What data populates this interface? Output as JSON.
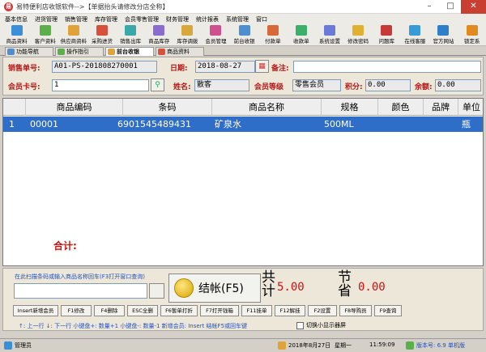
{
  "window": {
    "title": "易特便利店收银软件-->【单据抬头请修改分店全称】",
    "min": "–",
    "max": "□",
    "close": "✕"
  },
  "menu": [
    "基本信息",
    "进货管理",
    "销售管理",
    "库存管理",
    "会员零售管理",
    "财务管理",
    "统计报表",
    "系统管理",
    "窗口"
  ],
  "toolbar": [
    {
      "label": "商品资料",
      "color": "#3a8fd8"
    },
    {
      "label": "客户资料",
      "color": "#5bb04b"
    },
    {
      "label": "供应商资料",
      "color": "#e2a23a"
    },
    {
      "label": "采购进货",
      "color": "#d8503a"
    },
    {
      "label": "销售出库",
      "color": "#3aa8a8"
    },
    {
      "label": "商品库存",
      "color": "#8a6bd0"
    },
    {
      "label": "库存调拨",
      "color": "#d8a83a"
    },
    {
      "label": "会员管理",
      "color": "#cf4f8f"
    },
    {
      "label": "前台收银",
      "color": "#4f8fcf"
    },
    {
      "label": "付款单",
      "color": "#d86a3a"
    },
    {
      "label": "收款单",
      "color": "#3ab06a"
    },
    {
      "label": "系统设置",
      "color": "#6a7ad8"
    },
    {
      "label": "修改密码",
      "color": "#e0b030"
    },
    {
      "label": "问题库",
      "color": "#c83a3a"
    },
    {
      "label": "在线客服",
      "color": "#3a9ad8"
    },
    {
      "label": "官方网站",
      "color": "#2f7fc8"
    },
    {
      "label": "锁定系",
      "color": "#e08a20"
    }
  ],
  "tabs": [
    {
      "label": "功能导航",
      "color": "#4f8fcf",
      "active": false
    },
    {
      "label": "操作指引",
      "color": "#5bb04b",
      "active": false
    },
    {
      "label": "前台收银",
      "color": "#e2a23a",
      "active": true
    },
    {
      "label": "商品资料",
      "color": "#d8503a",
      "active": false
    }
  ],
  "form": {
    "order_no_label": "销售单号:",
    "order_no": "A01-PS-201808270001",
    "date_label": "日期:",
    "date": "2018-08-27",
    "note_label": "备注:",
    "note": "",
    "card_label": "会员卡号:",
    "card": "1",
    "name_label": "姓名:",
    "name": "散客",
    "level_label": "会员等级",
    "level": "零售会员",
    "points_label": "积分:",
    "points": "0.00",
    "balance_label": "余额:",
    "balance": "0.00"
  },
  "grid": {
    "headers": [
      "商品编码",
      "条码",
      "商品名称",
      "规格",
      "颜色",
      "品牌",
      "单位"
    ],
    "rows": [
      {
        "index": "1",
        "code": "00001",
        "barcode": "6901545489431",
        "name": "矿泉水",
        "spec": "500ML",
        "color": "",
        "brand": "",
        "unit": "瓶"
      }
    ],
    "total_label": "合计:"
  },
  "bottom": {
    "scan_label": "在此扫描条码或输入商品名称回车(F3打开窗口查询)",
    "checkout": "结帐(F5)",
    "sum_label": "共计",
    "sum_value": "5.00",
    "save_label": "节省",
    "save_value": "0.00",
    "fkeys": [
      "Insert新增会员",
      "F1修改",
      "F4删除",
      "ESC全删",
      "F6暂单打折",
      "F7打开钱箱",
      "F11挂单",
      "F12解挂",
      "F2设置",
      "F8导购员",
      "F9查询"
    ],
    "hint": "↑: 上一行    ↓: 下一行    小键盘+: 数量+1    小键盘-: 数量-1    新增会员: Insert    结帐F5或回车键",
    "checkbox_label": "切换小显示器屏"
  },
  "status": {
    "user": "管理员",
    "date": "2018年8月27日",
    "weekday": "星期一",
    "time": "11:59:09",
    "version": "版本号: 6.9 单机版"
  }
}
